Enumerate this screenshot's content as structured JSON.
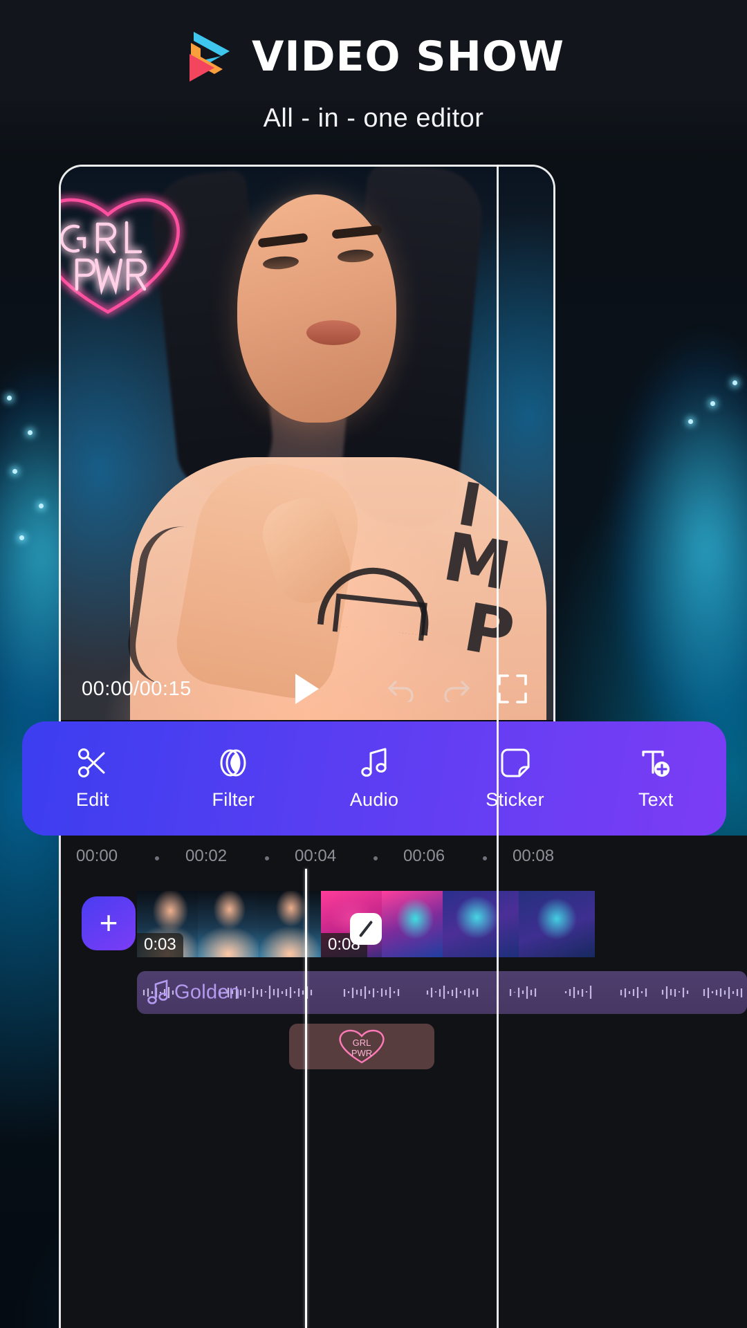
{
  "header": {
    "logo_icon": "videoshow-play-logo",
    "title": "VIDEO SHOW",
    "subtitle": "All - in - one editor"
  },
  "preview": {
    "sticker_overlay": {
      "line1": "GRL",
      "line2": "PWR",
      "icon": "neon-heart-icon",
      "color": "#ff4fa0"
    },
    "controls": {
      "time": "00:00/00:15",
      "play_icon": "play-icon",
      "undo_icon": "undo-arrow-icon",
      "redo_icon": "redo-arrow-icon",
      "fullscreen_icon": "fullscreen-expand-icon"
    }
  },
  "toolbar": {
    "accent_start": "#3b3ef0",
    "accent_end": "#7b3df5",
    "items": [
      {
        "label": "Edit",
        "icon": "scissors-icon"
      },
      {
        "label": "Filter",
        "icon": "filter-circles-icon"
      },
      {
        "label": "Audio",
        "icon": "music-note-icon"
      },
      {
        "label": "Sticker",
        "icon": "sticker-square-icon"
      },
      {
        "label": "Text",
        "icon": "text-add-icon"
      }
    ]
  },
  "timeline": {
    "ruler_ticks": [
      "00:00",
      "00:02",
      "00:04",
      "00:06",
      "00:08"
    ],
    "add_button_label": "+",
    "clips": [
      {
        "duration": "0:03"
      },
      {
        "duration": ""
      },
      {
        "duration": ""
      },
      {
        "duration": "0:08"
      },
      {
        "duration": ""
      },
      {
        "duration": ""
      },
      {
        "duration": ""
      }
    ],
    "transition_icon": "transition-slash-icon",
    "audio": {
      "name": "Golden",
      "icon": "music-note-icon",
      "color": "#b49bf0"
    },
    "sticker_clip": {
      "line1": "GRL",
      "line2": "PWR",
      "icon": "neon-heart-icon"
    }
  }
}
